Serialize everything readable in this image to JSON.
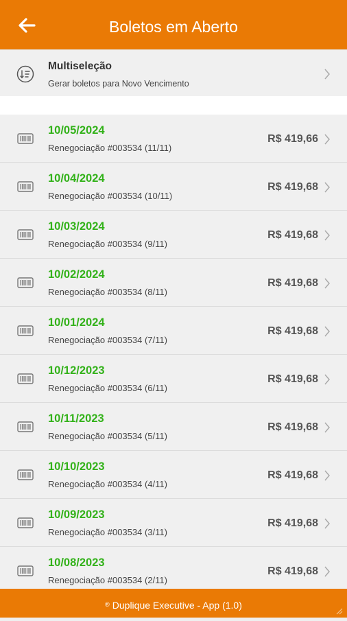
{
  "header": {
    "title": "Boletos em Aberto",
    "back_icon": "arrow-left-icon"
  },
  "multiselect": {
    "title": "Multiseleção",
    "subtitle": "Gerar boletos para Novo Vencimento",
    "icon": "sort-list-icon"
  },
  "boletos": [
    {
      "date": "10/05/2024",
      "desc": "Renegociação #003534 (11/11)",
      "amount": "R$ 419,66"
    },
    {
      "date": "10/04/2024",
      "desc": "Renegociação #003534 (10/11)",
      "amount": "R$ 419,68"
    },
    {
      "date": "10/03/2024",
      "desc": "Renegociação #003534 (9/11)",
      "amount": "R$ 419,68"
    },
    {
      "date": "10/02/2024",
      "desc": "Renegociação #003534 (8/11)",
      "amount": "R$ 419,68"
    },
    {
      "date": "10/01/2024",
      "desc": "Renegociação #003534 (7/11)",
      "amount": "R$ 419,68"
    },
    {
      "date": "10/12/2023",
      "desc": "Renegociação #003534 (6/11)",
      "amount": "R$ 419,68"
    },
    {
      "date": "10/11/2023",
      "desc": "Renegociação #003534 (5/11)",
      "amount": "R$ 419,68"
    },
    {
      "date": "10/10/2023",
      "desc": "Renegociação #003534 (4/11)",
      "amount": "R$ 419,68"
    },
    {
      "date": "10/09/2023",
      "desc": "Renegociação #003534 (3/11)",
      "amount": "R$ 419,68"
    },
    {
      "date": "10/08/2023",
      "desc": "Renegociação #003534 (2/11)",
      "amount": "R$ 419,68"
    }
  ],
  "footer": {
    "text": "Duplique Executive - App (1.0)"
  },
  "colors": {
    "primary": "#ea7a05",
    "date_green": "#33b21a",
    "row_bg": "#f0f0f0"
  }
}
